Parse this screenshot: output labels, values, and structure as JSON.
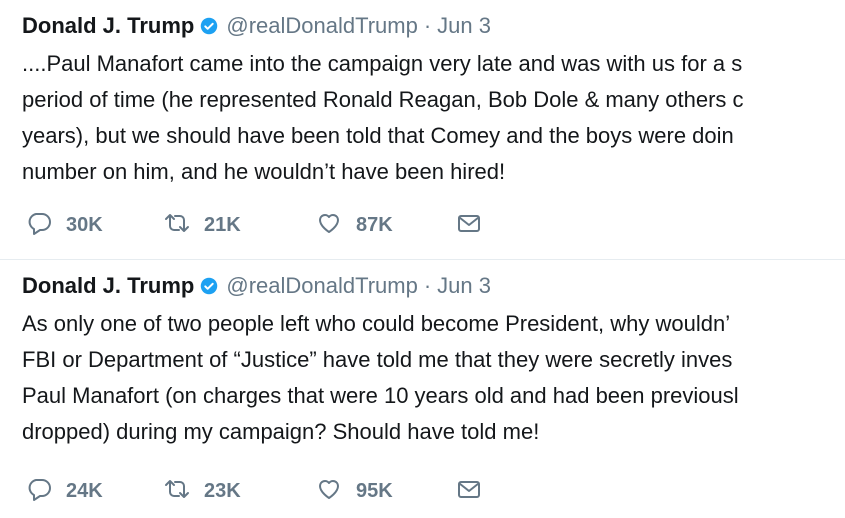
{
  "tweets": [
    {
      "author_name": "Donald J. Trump",
      "handle": "@realDonaldTrump",
      "separator": "·",
      "date": "Jun 3",
      "lines": [
        "....Paul Manafort came into the campaign very late and was with us for a s",
        "period of time (he represented Ronald Reagan, Bob Dole & many others c",
        "years), but we should have been told that Comey and the boys were doin",
        "number on him, and he wouldn’t have been hired!"
      ],
      "replies": "30K",
      "retweets": "21K",
      "likes": "87K"
    },
    {
      "author_name": "Donald J. Trump",
      "handle": "@realDonaldTrump",
      "separator": "·",
      "date": "Jun 3",
      "lines": [
        "As only one of two people left who could become President, why wouldn’",
        "FBI or Department of “Justice” have told me that they were secretly inves",
        "Paul Manafort (on charges that were 10 years old and had been previousl",
        "dropped) during my campaign? Should have told me!"
      ],
      "replies": "24K",
      "retweets": "23K",
      "likes": "95K"
    }
  ],
  "colors": {
    "text": "#14171a",
    "muted": "#657786",
    "verified": "#1da1f2",
    "divider": "#e6ecf0"
  },
  "icons": {
    "verified": "verified-badge-icon",
    "reply": "reply-bubble-icon",
    "retweet": "retweet-arrows-icon",
    "like": "heart-outline-icon",
    "dm": "envelope-icon"
  }
}
